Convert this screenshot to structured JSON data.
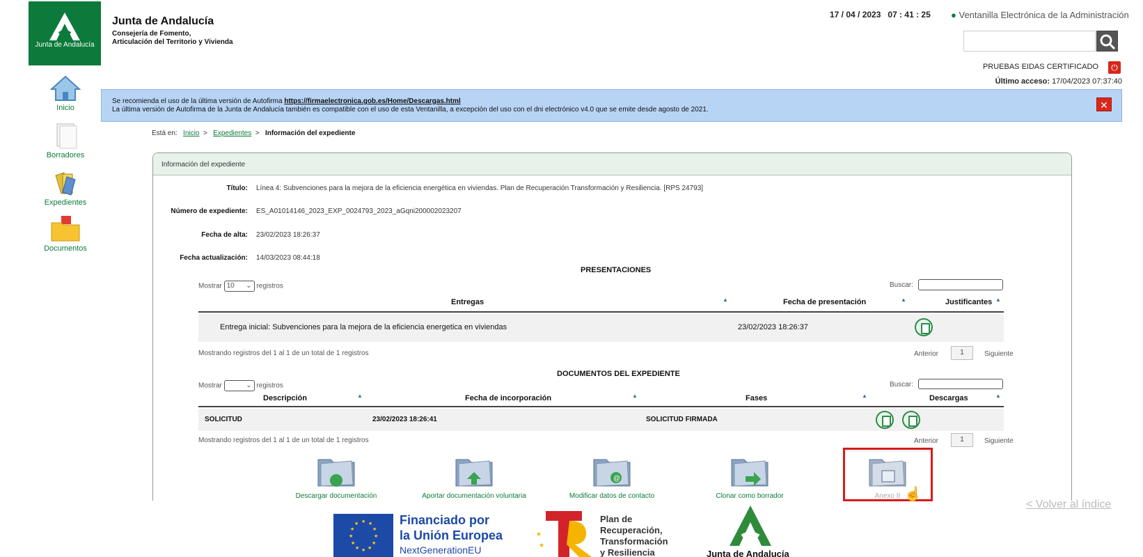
{
  "header": {
    "logo_text": "Junta de Andalucía",
    "org_title": "Junta de Andalucía",
    "org_sub_1": "Consejería de Fomento,",
    "org_sub_2": "Articulación del Territorio y Vivienda",
    "datetime": "17 / 04 / 2023   07 : 41 : 25",
    "ventanilla": "Ventanilla Electrónica de la Administración",
    "search_placeholder": "",
    "user": "PRUEBAS EIDAS CERTIFICADO",
    "last_access_label": "Último acceso:",
    "last_access_value": "17/04/2023 07:37:40"
  },
  "nav": {
    "items": [
      {
        "label": "Inicio"
      },
      {
        "label": "Borradores"
      },
      {
        "label": "Expedientes"
      },
      {
        "label": "Documentos"
      }
    ]
  },
  "notice": {
    "line1_prefix": "Se recomienda el uso de la última versión de Autofirma",
    "line1_link": "https://firmaelectronica.gob.es/Home/Descargas.html",
    "line2": "La última versión de Autofirma de la Junta de Andalucía también es compatible con el uso de esta Ventanilla, a excepción del uso con el dni electrónico v4.0 que se emite desde agosto de 2021."
  },
  "breadcrumb": {
    "prefix": "Está en:",
    "items": [
      "Inicio",
      "Expedientes"
    ],
    "current": "Información del expediente",
    "sep": ">"
  },
  "panel": {
    "title": "Información del expediente",
    "fields": [
      {
        "label": "Título:",
        "value": "Línea 4: Subvenciones para la mejora de la eficiencia energética en viviendas. Plan de Recuperación Transformación y Resiliencia. [RPS 24793]"
      },
      {
        "label": "Número de expediente:",
        "value": "ES_A01014146_2023_EXP_0024793_2023_aGqni200002023207"
      },
      {
        "label": "Fecha de alta:",
        "value": "23/02/2023 18:26:37"
      },
      {
        "label": "Fecha actualización:",
        "value": "14/03/2023 08:44:18"
      }
    ]
  },
  "presentaciones": {
    "title": "PRESENTACIONES",
    "mostrar": "Mostrar",
    "registros": "registros",
    "page_size": "10",
    "buscar": "Buscar:",
    "headers": [
      "Entregas",
      "Fecha de presentación",
      "Justificantes"
    ],
    "rows": [
      {
        "entrega": "Entrega inicial: Subvenciones para la mejora de la eficiencia energetica en viviendas",
        "fecha": "23/02/2023 18:26:37"
      }
    ],
    "info": "Mostrando registros del 1 al 1 de un total de 1 registros",
    "prev": "Anterior",
    "page": "1",
    "next": "Siguiente"
  },
  "documentos": {
    "title": "DOCUMENTOS DEL EXPEDIENTE",
    "mostrar": "Mostrar",
    "registros": "registros",
    "page_size": "",
    "buscar": "Buscar:",
    "headers": [
      "Descripción",
      "Fecha de incorporación",
      "Fases",
      "Descargas"
    ],
    "rows": [
      {
        "descripcion": "SOLICITUD",
        "fecha": "23/02/2023 18:26:41",
        "fase": "SOLICITUD FIRMADA"
      }
    ],
    "info": "Mostrando registros del 1 al 1 de un total de 1 registros",
    "prev": "Anterior",
    "page": "1",
    "next": "Siguiente"
  },
  "actions": [
    {
      "label": "Descargar documentación"
    },
    {
      "label": "Aportar documentación voluntaria"
    },
    {
      "label": "Modificar datos de contacto"
    },
    {
      "label": "Clonar como borrador"
    },
    {
      "label": "Anexo II"
    }
  ],
  "footer": {
    "volver": "< Volver al índice",
    "eu_line1": "Financiado por",
    "eu_line2": "la Unión Europea",
    "eu_line3": "NextGenerationEU",
    "prtr_1": "Plan de",
    "prtr_2": "Recuperación,",
    "prtr_3": "Transformación",
    "prtr_4": "y Resiliencia",
    "ja_name": "Junta de Andalucía"
  },
  "colors": {
    "brand_green": "#0b7a3a",
    "notice_blue": "#b8d4f5",
    "highlight_red": "#d81b1b"
  }
}
